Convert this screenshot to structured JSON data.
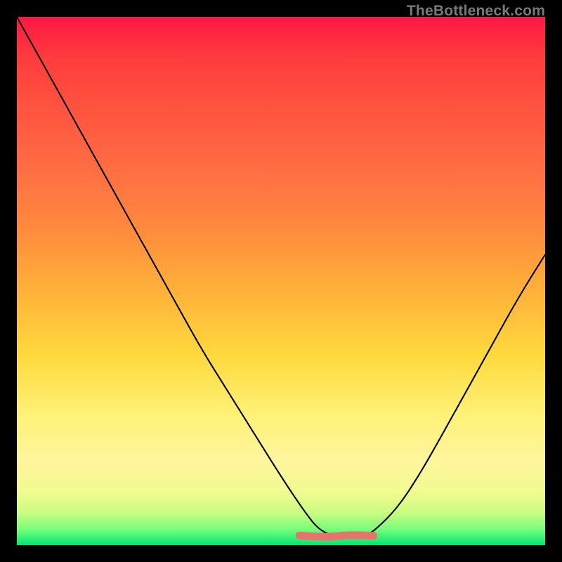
{
  "watermark": "TheBottleneck.com",
  "colors": {
    "page_bg": "#000000",
    "curve": "#000000",
    "accent_segment": "#e8736b",
    "gradient_top": "#ff1744",
    "gradient_bottom": "#00e676"
  },
  "chart_data": {
    "type": "line",
    "title": "",
    "xlabel": "",
    "ylabel": "",
    "xlim": [
      0,
      100
    ],
    "ylim": [
      0,
      100
    ],
    "grid": false,
    "legend": false,
    "description": "V-shaped bottleneck curve descending from top-left to a flat valley near x≈57–67, then rising toward the right. A short salmon-colored band highlights the valley region.",
    "series": [
      {
        "name": "bottleneck-curve",
        "color": "#000000",
        "x": [
          0,
          5,
          10,
          15,
          20,
          25,
          30,
          35,
          40,
          45,
          50,
          54,
          57,
          60,
          63,
          66,
          68,
          72,
          76,
          80,
          85,
          90,
          95,
          100
        ],
        "y": [
          100,
          91,
          82,
          73,
          64,
          55,
          46,
          37,
          29,
          21,
          13,
          7,
          3,
          1.7,
          1.5,
          1.7,
          3,
          7,
          13,
          20,
          29,
          38,
          47,
          55
        ]
      }
    ],
    "highlight": {
      "name": "valley-band",
      "color": "#e8736b",
      "x_range": [
        53.5,
        67.5
      ],
      "y": 1.7,
      "thickness_px": 11
    }
  }
}
